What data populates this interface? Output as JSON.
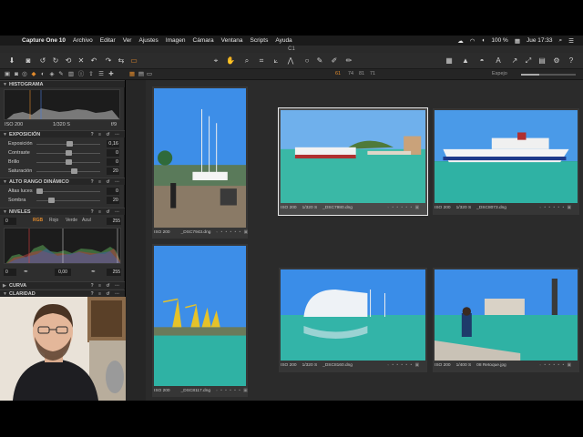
{
  "menubar": {
    "app_name": "Capture One 10",
    "menus": [
      "Archivo",
      "Editar",
      "Ver",
      "Ajustes",
      "Imagen",
      "Cámara",
      "Ventana",
      "Scripts",
      "Ayuda"
    ],
    "battery": "100 %",
    "clock": "Jue 17:33"
  },
  "window": {
    "title": "C1"
  },
  "subtoolbar": {
    "tab_numbers": [
      "61",
      "74",
      "81",
      "71"
    ],
    "zoom_label": "Espejo"
  },
  "panels": {
    "histogram": {
      "title": "HISTOGRAMA",
      "iso": "ISO 200",
      "shutter": "1/320 S",
      "aperture": "f/9"
    },
    "exposure": {
      "title": "EXPOSICIÓN",
      "rows": [
        {
          "label": "Exposición",
          "value": "0,16",
          "level": 0.52
        },
        {
          "label": "Contraste",
          "value": "0",
          "level": 0.5
        },
        {
          "label": "Brillo",
          "value": "0",
          "level": 0.5
        },
        {
          "label": "Saturación",
          "value": "20",
          "level": 0.6
        }
      ]
    },
    "hdr": {
      "title": "ALTO RANGO DINÁMICO",
      "rows": [
        {
          "label": "Altas luces",
          "value": "0",
          "level": 0.0
        },
        {
          "label": "Sombra",
          "value": "20",
          "level": 0.2
        }
      ]
    },
    "levels": {
      "title": "NIVELES",
      "low_value": "0",
      "high_value": "255",
      "tabs": [
        "RGB",
        "Rojo",
        "Verde",
        "Azul"
      ],
      "bottom_left": "0",
      "bottom_mid": "0,00",
      "bottom_right": "255"
    },
    "curve": {
      "title": "CURVA"
    },
    "clarity": {
      "title": "CLARIDAD"
    }
  },
  "thumbnails": [
    {
      "iso": "ISO 200",
      "shutter": "",
      "filename": "_DSC7943.dng",
      "selected": false,
      "scene": "boats"
    },
    {
      "iso": "ISO 200",
      "shutter": "1/320 S",
      "filename": "_DSC7980.dng",
      "selected": true,
      "scene": "ferry"
    },
    {
      "iso": "ISO 200",
      "shutter": "1/320 S",
      "filename": "_DSC8073.dng",
      "selected": false,
      "scene": "cruise"
    },
    {
      "iso": "ISO 200",
      "shutter": "",
      "filename": "_DSC8117.dng",
      "selected": false,
      "scene": "cranes"
    },
    {
      "iso": "ISO 200",
      "shutter": "1/320 S",
      "filename": "_DSC8160.dng",
      "selected": false,
      "scene": "hotel"
    },
    {
      "iso": "ISO 200",
      "shutter": "1/400 S",
      "filename": "08 Retoque.jpg",
      "selected": false,
      "scene": "photographer"
    }
  ],
  "colors": {
    "accent": "#e08a2c",
    "panel": "#2e2e2e",
    "browser": "#2b2b2b"
  }
}
